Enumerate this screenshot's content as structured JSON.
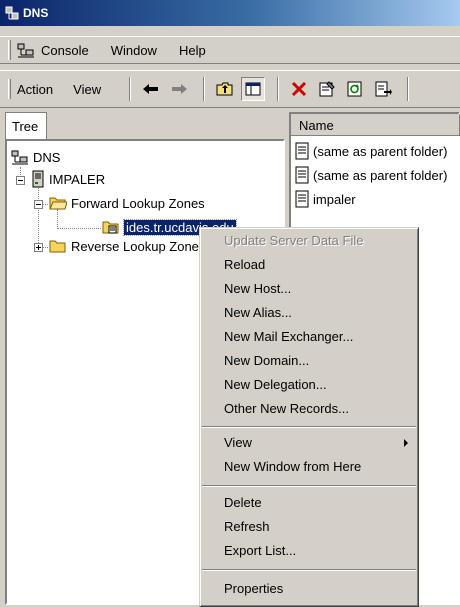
{
  "window": {
    "title": "DNS"
  },
  "menubar": {
    "console": "Console",
    "window": "Window",
    "help": "Help"
  },
  "toolbar": {
    "action": "Action",
    "view": "View",
    "buttons": [
      "back-arrow-icon",
      "forward-arrow-icon",
      "up-folder-icon",
      "show-hide-tree-icon",
      "delete-x-icon",
      "properties-icon",
      "refresh-icon",
      "export-list-icon"
    ]
  },
  "tree_tab": {
    "label": "Tree"
  },
  "tree": {
    "root": "DNS",
    "server": "IMPALER",
    "forward_zones": "Forward Lookup Zones",
    "zone": "ides.tr.ucdavis.edu",
    "reverse_zones": "Reverse Lookup Zones"
  },
  "list": {
    "column_name": "Name",
    "rows": [
      "(same as parent folder)",
      "(same as parent folder)",
      "impaler"
    ]
  },
  "context_menu": {
    "items": [
      {
        "label": "Update Server Data File",
        "disabled": true
      },
      {
        "label": "Reload"
      },
      {
        "label": "New Host..."
      },
      {
        "label": "New Alias..."
      },
      {
        "label": "New Mail Exchanger..."
      },
      {
        "label": "New Domain..."
      },
      {
        "label": "New Delegation..."
      },
      {
        "label": "Other New Records..."
      },
      {
        "label": "View",
        "submenu": true
      },
      {
        "label": "New Window from Here"
      },
      {
        "label": "Delete"
      },
      {
        "label": "Refresh"
      },
      {
        "label": "Export List..."
      },
      {
        "label": "Properties"
      }
    ]
  },
  "colors": {
    "title_bar": "#0a246a",
    "selection": "#0a246a",
    "face": "#d4d0c8",
    "delete_red": "#cc0000"
  }
}
